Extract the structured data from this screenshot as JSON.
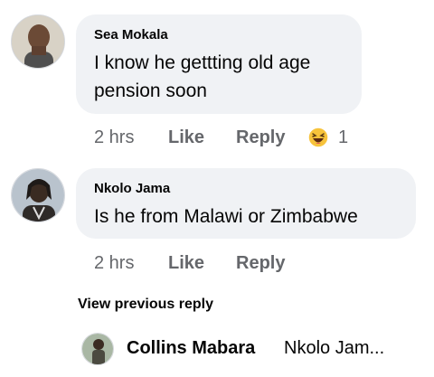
{
  "comments": [
    {
      "author": "Sea Mokala",
      "text_line1": "I know he gettting old age",
      "text_line2": "pension soon",
      "time": "2 hrs",
      "like_label": "Like",
      "reply_label": "Reply",
      "reaction_icon": "haha-reaction-icon",
      "reaction_count": "1"
    },
    {
      "author": "Nkolo Jama",
      "text": "Is he from Malawi or Zimbabwe",
      "time": "2 hrs",
      "like_label": "Like",
      "reply_label": "Reply"
    }
  ],
  "view_previous_label": "View previous reply",
  "reply_preview": {
    "author": "Collins Mabara",
    "text": "Nkolo Jam..."
  },
  "colors": {
    "bubble": "#f0f2f5",
    "meta_text": "#65676b",
    "haha_yellow": "#f7c33b"
  }
}
